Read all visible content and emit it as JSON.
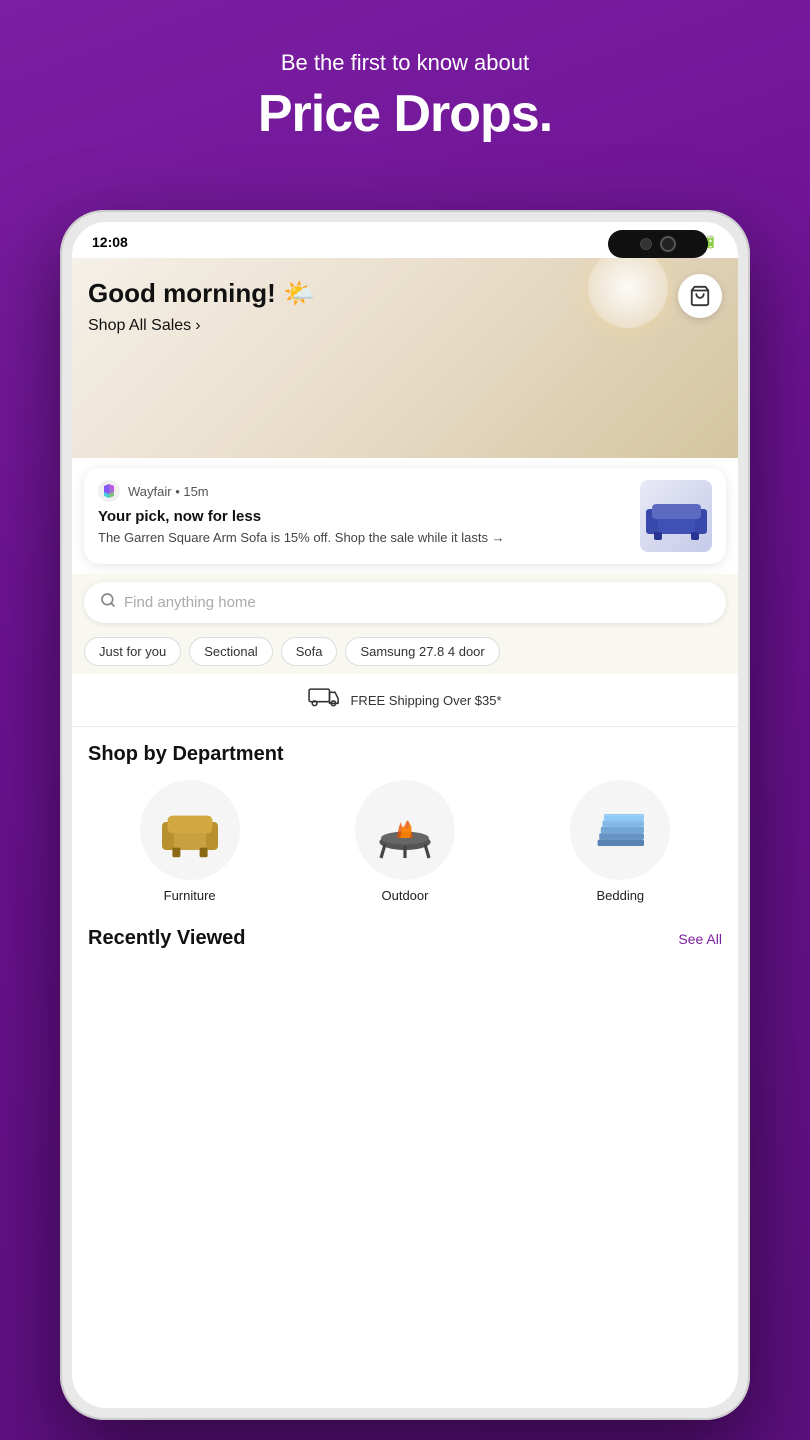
{
  "background": {
    "color": "#7b1fa2"
  },
  "header": {
    "subtitle": "Be the first to know about",
    "title": "Price Drops."
  },
  "status_bar": {
    "time": "12:08",
    "icons": "🔔 📶 🔋"
  },
  "hero": {
    "greeting": "Good morning! 🌤️",
    "shop_link": "Shop All Sales",
    "shop_arrow": "›"
  },
  "notification": {
    "source": "Wayfair • 15m",
    "title": "Your pick, now for less",
    "body": "The Garren Square Arm Sofa is 15% off. Shop the sale while it lasts →"
  },
  "search": {
    "placeholder": "Find anything home"
  },
  "chips": [
    {
      "label": "Just for you"
    },
    {
      "label": "Sectional"
    },
    {
      "label": "Sofa"
    },
    {
      "label": "Samsung 27.8 4 door"
    }
  ],
  "shipping": {
    "text": "FREE Shipping Over $35*"
  },
  "departments": {
    "title": "Shop by Department",
    "items": [
      {
        "label": "Furniture"
      },
      {
        "label": "Outdoor"
      },
      {
        "label": "Bedding"
      }
    ]
  },
  "recently": {
    "title": "Recently Viewed",
    "see_all": "See All"
  }
}
